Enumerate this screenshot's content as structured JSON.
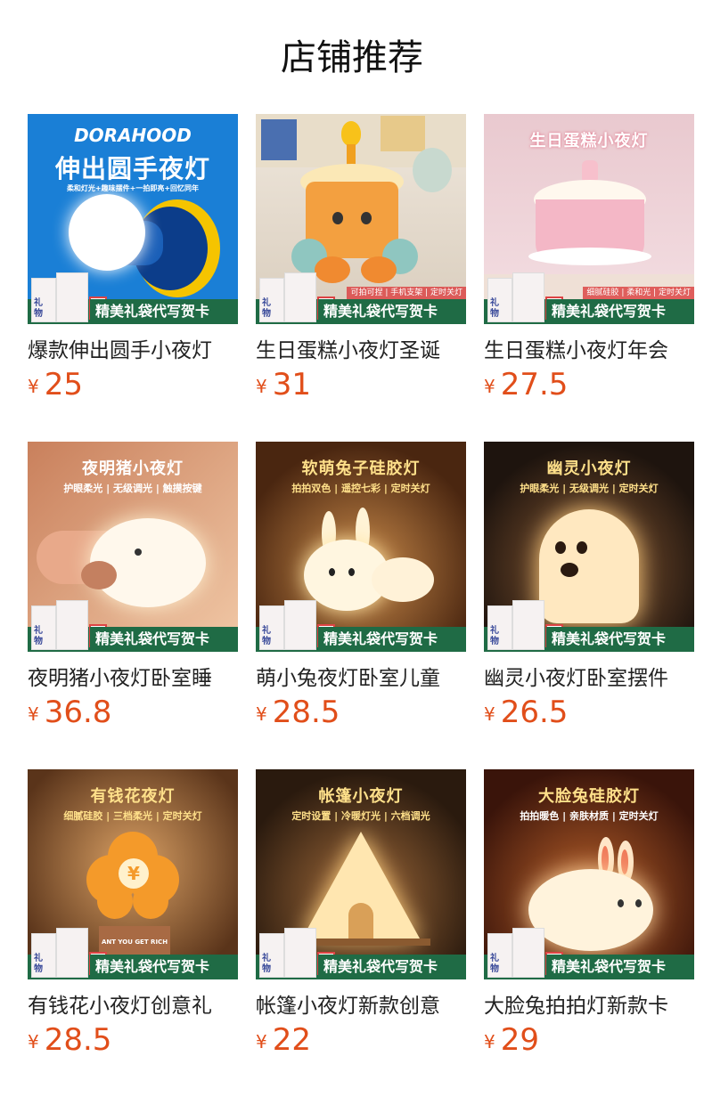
{
  "page_title": "店铺推荐",
  "gift_banner_text": "精美礼袋代写贺卡",
  "currency": "¥",
  "products": [
    {
      "name": "爆款伸出圆手小夜灯",
      "price": "25",
      "thumb": {
        "title": "伸出圆手夜灯",
        "subtitle": "柔和灯光+趣味摆件+一拍即亮+回忆同年",
        "brand": "DORAHOOD",
        "bg": "#1a7fd6"
      }
    },
    {
      "name": "生日蛋糕小夜灯圣诞",
      "price": "31",
      "thumb": {
        "features": "可拍可捏 | 手机支架 | 定时关灯",
        "bg": "#e9e2d7"
      }
    },
    {
      "name": "生日蛋糕小夜灯年会",
      "price": "27.5",
      "thumb": {
        "title": "生日蛋糕小夜灯",
        "features": "细腻硅胶 | 柔和光 | 定时关灯",
        "bg": "#f2d6dc"
      }
    },
    {
      "name": "夜明猪小夜灯卧室睡",
      "price": "36.8",
      "thumb": {
        "title": "夜明猪小夜灯",
        "subtitle": "护眼柔光 | 无级调光 | 触摸按键",
        "bg": "#d79b74"
      }
    },
    {
      "name": "萌小兔夜灯卧室儿童",
      "price": "28.5",
      "thumb": {
        "title": "软萌兔子硅胶灯",
        "subtitle": "拍拍双色 | 遥控七彩 | 定时关灯",
        "bg": "#6b3a18"
      }
    },
    {
      "name": "幽灵小夜灯卧室摆件",
      "price": "26.5",
      "thumb": {
        "title": "幽灵小夜灯",
        "subtitle": "护眼柔光 | 无级调光 | 定时关灯",
        "bg": "#3a2a1e"
      }
    },
    {
      "name": "有钱花小夜灯创意礼",
      "price": "28.5",
      "thumb": {
        "title": "有钱花夜灯",
        "subtitle": "细腻硅胶 | 三档柔光 | 定时关灯",
        "pot_text": "ANT YOU GET RICH",
        "bg": "#7a4a28"
      }
    },
    {
      "name": "帐篷小夜灯新款创意",
      "price": "22",
      "thumb": {
        "title": "帐篷小夜灯",
        "subtitle": "定时设置 | 冷暖灯光 | 六档调光",
        "bg": "#3b2a1a"
      }
    },
    {
      "name": "大脸兔拍拍灯新款卡",
      "price": "29",
      "thumb": {
        "title": "大脸兔硅胶灯",
        "subtitle": "拍拍暖色 | 亲肤材质 | 定时关灯",
        "bg": "#6a2a14"
      }
    }
  ],
  "colors": {
    "price": "#e14e1a",
    "banner": "#1f6b45"
  }
}
